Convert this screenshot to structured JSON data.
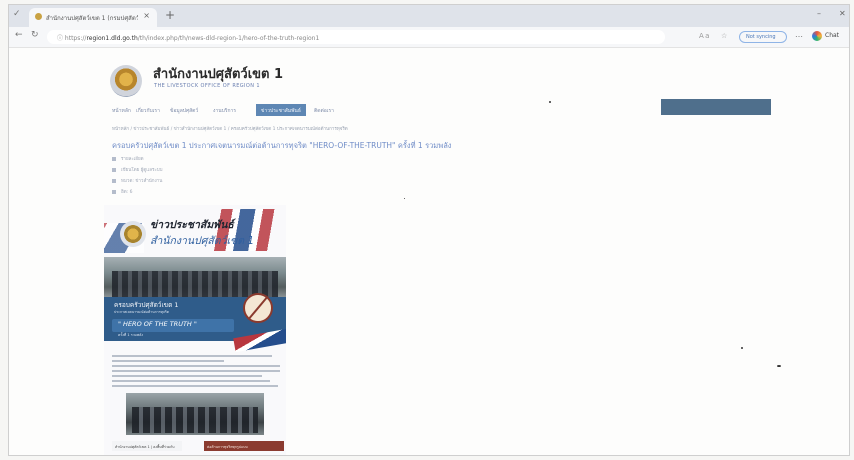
{
  "browser": {
    "tab_title": "สำนักงานปศุสัตว์เขต 1 (กรมปศุสัตว์)",
    "tab_close": "×",
    "new_tab": "+",
    "address": {
      "scheme": "https://",
      "host": "region1.dld.go.th",
      "path": "/th/index.php/th/news-dld-region-1/hero-of-the-truth-region1"
    },
    "sign_in_label": "Not syncing",
    "chat_label": "Chat",
    "icons": [
      "tab-actions-icon",
      "close-icon",
      "new-tab-icon",
      "back-icon",
      "refresh-icon",
      "site-info-icon",
      "read-aloud-icon",
      "favorite-icon",
      "more-icon",
      "copilot-icon",
      "minimize-icon",
      "window-close-icon"
    ]
  },
  "site": {
    "title": "สำนักงานปศุสัตว์เขต 1",
    "subtitle": "THE LIVESTOCK OFFICE OF REGION 1"
  },
  "menu": [
    {
      "label": "หน้าหลัก"
    },
    {
      "label": "เกี่ยวกับเรา"
    },
    {
      "label": "ข้อมูลปศุสัตว์"
    },
    {
      "label": "งานบริการ"
    },
    {
      "label": "ข่าวประชาสัมพันธ์",
      "active": true
    },
    {
      "label": "ติดต่อเรา"
    }
  ],
  "breadcrumb": "หน้าหลัก / ข่าวประชาสัมพันธ์ / ข่าวสำนักงานปศุสัตว์เขต 1 / ครอบครัวปศุสัตว์เขต 1 ประกาศเจตนารมณ์ต่อต้านการทุจริต",
  "article": {
    "title": "ครอบครัวปศุสัตว์เขต 1 ประกาศเจตนารมณ์ต่อต้านการทุจริต \"HERO-OF-THE-TRUTH\" ครั้งที่ 1 รวมพลัง",
    "meta": [
      "รายละเอียด",
      "เขียนโดย ผู้ดูแลระบบ",
      "หมวด: ข่าวสำนักงาน",
      "ฮิต: 6"
    ]
  },
  "poster": {
    "heading1": "ข่าวประชาสัมพันธ์",
    "heading2": "สำนักงานปศุสัตว์เขต 1",
    "band_title": "ครอบครัวปศุสัตว์เขต 1",
    "band_sub": "ประกาศเจตนารมณ์ต่อต้านการทุจริต",
    "hero": "\" HERO OF THE TRUTH \"",
    "hero_sub": "ครั้งที่ 1 รวมพลัง",
    "footer_left": "สำนักงานปศุสัตว์เขต 1 | ลงพื้นที่ร่วมกับ",
    "footer_right": "ต่อต้านการทุจริตทุกรูปแบบ"
  }
}
